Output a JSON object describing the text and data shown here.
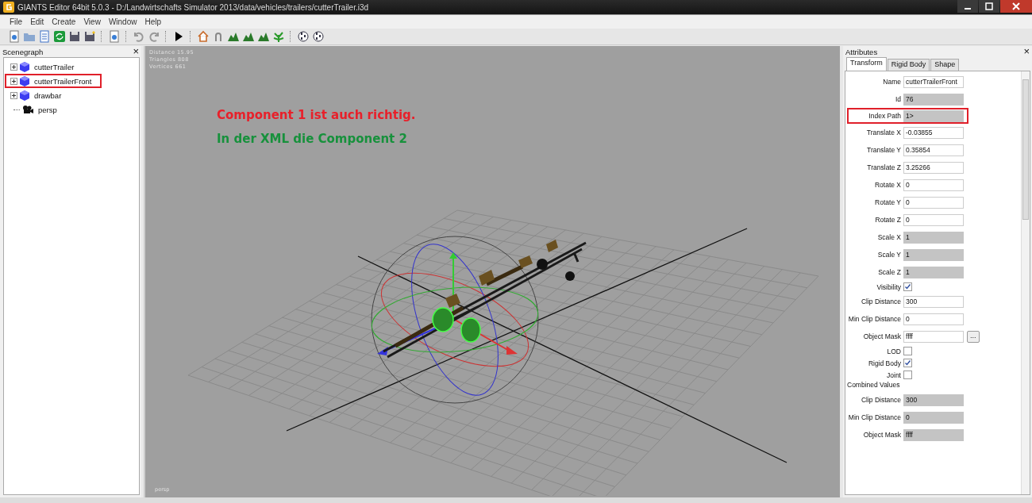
{
  "window": {
    "title": "GIANTS Editor 64bit 5.0.3 - D:/Landwirtschafts Simulator 2013/data/vehicles/trailers/cutterTrailer.i3d"
  },
  "menu": [
    "File",
    "Edit",
    "Create",
    "View",
    "Window",
    "Help"
  ],
  "scenegraph": {
    "title": "Scenegraph",
    "close": "×",
    "items": [
      {
        "label": "cutterTrailer",
        "kind": "group",
        "expanded": false,
        "highlighted": false
      },
      {
        "label": "cutterTrailerFront",
        "kind": "group",
        "expanded": false,
        "highlighted": true
      },
      {
        "label": "drawbar",
        "kind": "group",
        "expanded": false,
        "highlighted": false
      },
      {
        "label": "persp",
        "kind": "camera",
        "highlighted": false
      }
    ]
  },
  "viewport": {
    "stats": [
      "Distance 15.95",
      "Triangles 808",
      "Vertices 661"
    ],
    "camera": "persp",
    "notes": [
      {
        "text": "Component 1 ist auch richtig.",
        "color": "#e8202a"
      },
      {
        "text": "In der XML die Component 2",
        "color": "#17913c"
      }
    ]
  },
  "attributes": {
    "title": "Attributes",
    "close": "×",
    "tabs": [
      {
        "label": "Transform",
        "selected": true
      },
      {
        "label": "Rigid Body",
        "selected": false
      },
      {
        "label": "Shape",
        "selected": false
      }
    ],
    "rows": [
      {
        "kind": "field",
        "label": "Name",
        "value": "cutterTrailerFront",
        "readonly": false,
        "highlighted": false
      },
      {
        "kind": "field",
        "label": "Id",
        "value": "76",
        "readonly": true,
        "highlighted": false
      },
      {
        "kind": "field",
        "label": "Index Path",
        "value": "1>",
        "readonly": true,
        "highlighted": true
      },
      {
        "kind": "field",
        "label": "Translate X",
        "value": "-0.03855",
        "readonly": false,
        "highlighted": false
      },
      {
        "kind": "field",
        "label": "Translate Y",
        "value": "0.35854",
        "readonly": false,
        "highlighted": false
      },
      {
        "kind": "field",
        "label": "Translate Z",
        "value": "3.25266",
        "readonly": false,
        "highlighted": false
      },
      {
        "kind": "field",
        "label": "Rotate X",
        "value": "0",
        "readonly": false,
        "highlighted": false
      },
      {
        "kind": "field",
        "label": "Rotate Y",
        "value": "0",
        "readonly": false,
        "highlighted": false
      },
      {
        "kind": "field",
        "label": "Rotate Z",
        "value": "0",
        "readonly": false,
        "highlighted": false
      },
      {
        "kind": "field",
        "label": "Scale X",
        "value": "1",
        "readonly": true,
        "highlighted": false
      },
      {
        "kind": "field",
        "label": "Scale Y",
        "value": "1",
        "readonly": true,
        "highlighted": false
      },
      {
        "kind": "field",
        "label": "Scale Z",
        "value": "1",
        "readonly": true,
        "highlighted": false
      },
      {
        "kind": "checkbox",
        "label": "Visibility",
        "checked": true
      },
      {
        "kind": "field",
        "label": "Clip Distance",
        "value": "300",
        "readonly": false,
        "highlighted": false
      },
      {
        "kind": "field",
        "label": "Min Clip Distance",
        "value": "0",
        "readonly": false,
        "highlighted": false
      },
      {
        "kind": "field",
        "label": "Object Mask",
        "value": "ffff",
        "readonly": false,
        "highlighted": false,
        "button": "..."
      },
      {
        "kind": "checkbox",
        "label": "LOD",
        "checked": false
      },
      {
        "kind": "checkbox",
        "label": "Rigid Body",
        "checked": true
      },
      {
        "kind": "checkbox",
        "label": "Joint",
        "checked": false
      },
      {
        "kind": "heading",
        "label": "Combined Values"
      },
      {
        "kind": "field",
        "label": "Clip Distance",
        "value": "300",
        "readonly": true,
        "highlighted": false
      },
      {
        "kind": "field",
        "label": "Min Clip Distance",
        "value": "0",
        "readonly": true,
        "highlighted": false
      },
      {
        "kind": "field",
        "label": "Object Mask",
        "value": "ffff",
        "readonly": true,
        "highlighted": false
      }
    ]
  }
}
